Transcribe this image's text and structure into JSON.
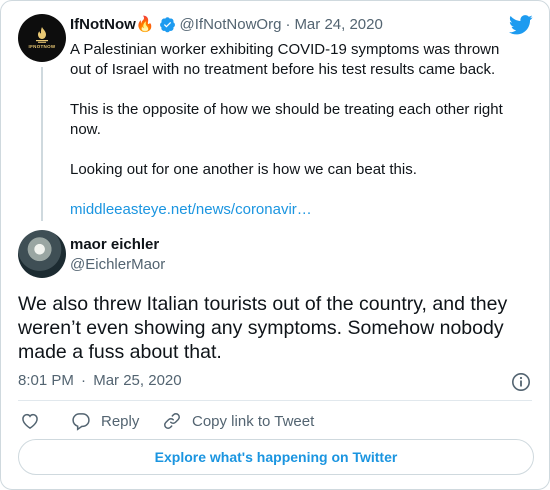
{
  "quoted_tweet": {
    "avatar_text": "IFNOTNOW",
    "display_name": "IfNotNow",
    "name_emoji": "🔥",
    "handle": "@IfNotNowOrg",
    "separator": "·",
    "date": "Mar 24, 2020",
    "paragraphs": [
      "A Palestinian worker exhibiting COVID-19 symptoms was thrown out of Israel with no treatment before his test results came back.",
      "This is the opposite of how we should be treating each other right now.",
      "Looking out for one another is how we can beat this."
    ],
    "link": "middleeasteye.net/news/coronavir…"
  },
  "tweet": {
    "display_name": "maor eichler",
    "handle": "@EichlerMaor",
    "text": "We also threw Italian tourists out of the country, and they weren’t even showing any symptoms. Somehow nobody made a fuss about that.",
    "time": "8:01 PM",
    "separator": "·",
    "date": "Mar 25, 2020"
  },
  "actions": {
    "reply_label": "Reply",
    "copy_link_label": "Copy link to Tweet"
  },
  "explore_label": "Explore what's happening on Twitter",
  "colors": {
    "accent": "#1b95e0",
    "verified": "#1d9bf0",
    "twitter_brand": "#1d9bf0",
    "muted": "#536471",
    "border": "#cfd9de"
  },
  "icons": [
    "twitter-bird-icon",
    "verified-badge-icon",
    "info-icon",
    "heart-icon",
    "reply-icon",
    "link-icon",
    "flame-logo-icon"
  ]
}
